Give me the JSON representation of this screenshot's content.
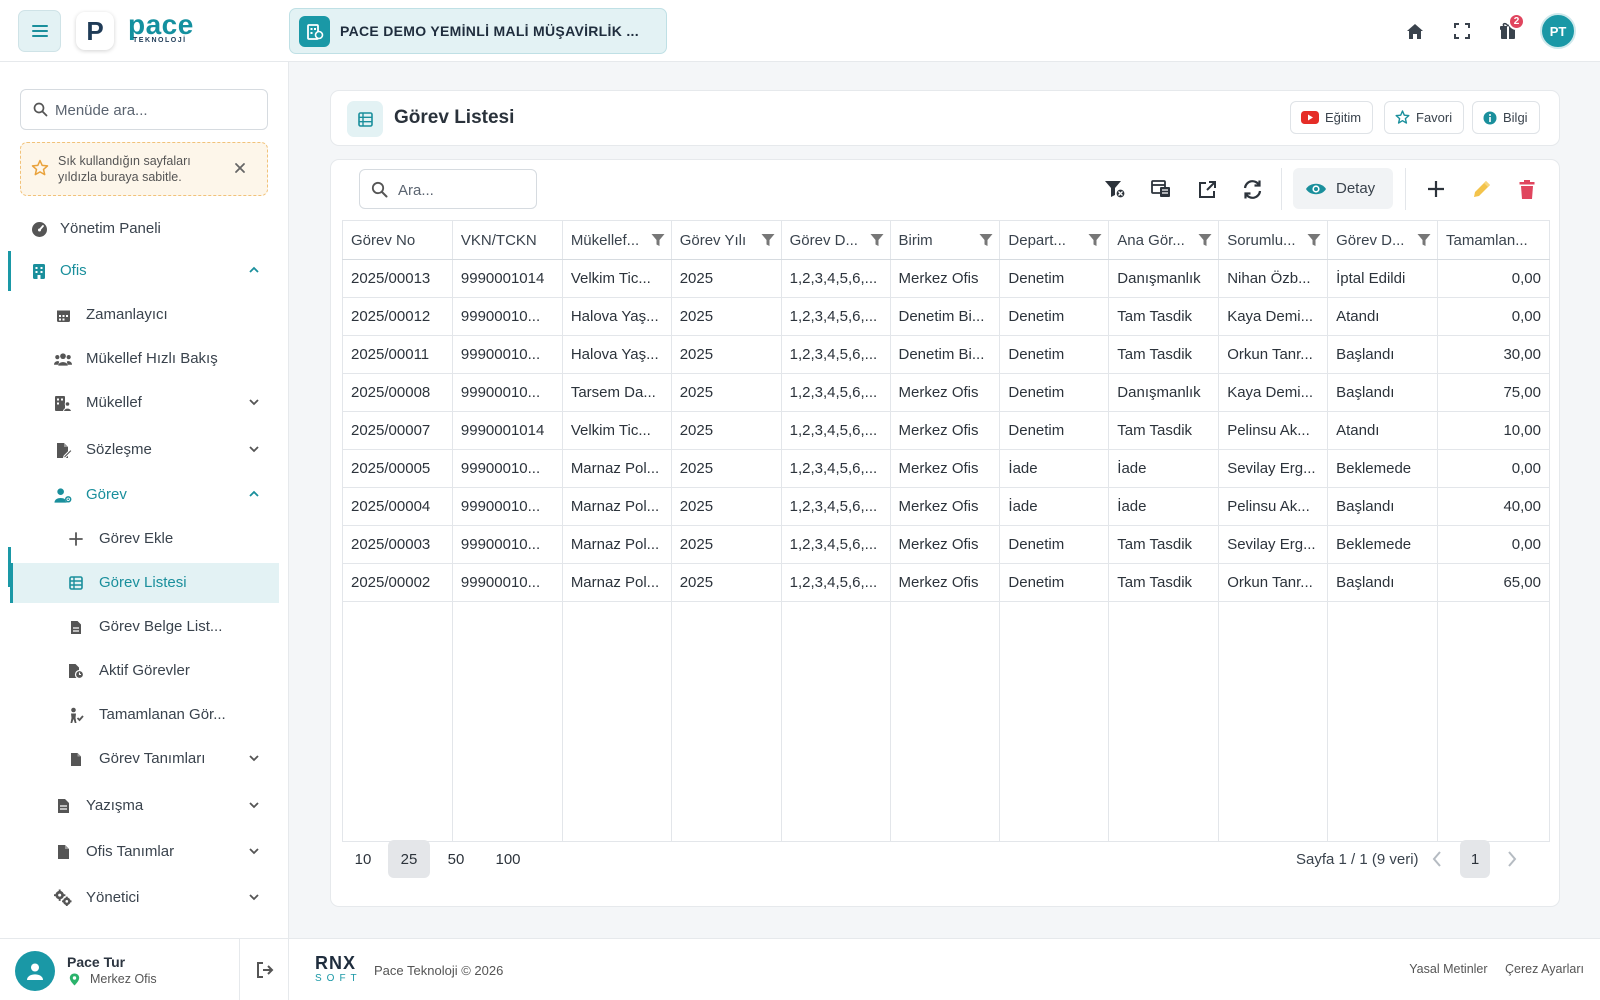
{
  "header": {
    "logo_letter": "P",
    "logo_word": "pace",
    "logo_sub": "TEKNOLOJİ",
    "company_name": "PACE DEMO YEMİNLİ MALİ MÜŞAVİRLİK ...",
    "notification_count": "2",
    "avatar_initials": "PT",
    "accent_color": "#1a98a6"
  },
  "sidebar": {
    "search_placeholder": "Menüde ara...",
    "tip_text": "Sık kullandığın sayfaları yıldızla buraya sabitle.",
    "items": [
      {
        "label": "Yönetim Paneli",
        "icon": "gauge-icon"
      },
      {
        "label": "Ofis",
        "icon": "building-icon"
      },
      {
        "label": "Zamanlayıcı",
        "icon": "calendar-icon"
      },
      {
        "label": "Mükellef Hızlı Bakış",
        "icon": "users-icon"
      },
      {
        "label": "Mükellef",
        "icon": "user-building-icon"
      },
      {
        "label": "Sözleşme",
        "icon": "contract-icon"
      },
      {
        "label": "Görev",
        "icon": "user-gear-icon"
      },
      {
        "label": "Görev Ekle",
        "icon": "plus-icon"
      },
      {
        "label": "Görev Listesi",
        "icon": "table-list-icon"
      },
      {
        "label": "Görev Belge List...",
        "icon": "file-icon"
      },
      {
        "label": "Aktif Görevler",
        "icon": "file-clock-icon"
      },
      {
        "label": "Tamamlanan Gör...",
        "icon": "person-check-icon"
      },
      {
        "label": "Görev Tanımları",
        "icon": "file-lines-icon"
      },
      {
        "label": "Yazışma",
        "icon": "file-text-icon"
      },
      {
        "label": "Ofis Tanımlar",
        "icon": "file-icon"
      },
      {
        "label": "Yönetici",
        "icon": "gears-icon"
      }
    ],
    "user": {
      "name": "Pace Tur",
      "office": "Merkez Ofis"
    }
  },
  "page": {
    "title": "Görev Listesi",
    "buttons": {
      "egitim": "Eğitim",
      "favori": "Favori",
      "bilgi": "Bilgi"
    }
  },
  "grid": {
    "search_placeholder": "Ara...",
    "detail_label": "Detay",
    "columns": [
      "Görev No",
      "VKN/TCKN",
      "Mükellef...",
      "Görev Yılı",
      "Görev D...",
      "Birim",
      "Depart...",
      "Ana Gör...",
      "Sorumlu...",
      "Görev D...",
      "Tamamlan..."
    ],
    "rows": [
      [
        "2025/00013",
        "9990001014",
        "Velkim Tic...",
        "2025",
        "1,2,3,4,5,6,...",
        "Merkez Ofis",
        "Denetim",
        "Danışmanlık",
        "Nihan Özb...",
        "İptal Edildi",
        "0,00"
      ],
      [
        "2025/00012",
        "99900010...",
        "Halova Yaş...",
        "2025",
        "1,2,3,4,5,6,...",
        "Denetim Bi...",
        "Denetim",
        "Tam Tasdik",
        "Kaya Demi...",
        "Atandı",
        "0,00"
      ],
      [
        "2025/00011",
        "99900010...",
        "Halova Yaş...",
        "2025",
        "1,2,3,4,5,6,...",
        "Denetim Bi...",
        "Denetim",
        "Tam Tasdik",
        "Orkun Tanr...",
        "Başlandı",
        "30,00"
      ],
      [
        "2025/00008",
        "99900010...",
        "Tarsem Da...",
        "2025",
        "1,2,3,4,5,6,...",
        "Merkez Ofis",
        "Denetim",
        "Danışmanlık",
        "Kaya Demi...",
        "Başlandı",
        "75,00"
      ],
      [
        "2025/00007",
        "9990001014",
        "Velkim Tic...",
        "2025",
        "1,2,3,4,5,6,...",
        "Merkez Ofis",
        "Denetim",
        "Tam Tasdik",
        "Pelinsu Ak...",
        "Atandı",
        "10,00"
      ],
      [
        "2025/00005",
        "99900010...",
        "Marnaz Pol...",
        "2025",
        "1,2,3,4,5,6,...",
        "Merkez Ofis",
        "İade",
        "İade",
        "Sevilay Erg...",
        "Beklemede",
        "0,00"
      ],
      [
        "2025/00004",
        "99900010...",
        "Marnaz Pol...",
        "2025",
        "1,2,3,4,5,6,...",
        "Merkez Ofis",
        "İade",
        "İade",
        "Pelinsu Ak...",
        "Başlandı",
        "40,00"
      ],
      [
        "2025/00003",
        "99900010...",
        "Marnaz Pol...",
        "2025",
        "1,2,3,4,5,6,...",
        "Merkez Ofis",
        "Denetim",
        "Tam Tasdik",
        "Sevilay Erg...",
        "Beklemede",
        "0,00"
      ],
      [
        "2025/00002",
        "99900010...",
        "Marnaz Pol...",
        "2025",
        "1,2,3,4,5,6,...",
        "Merkez Ofis",
        "Denetim",
        "Tam Tasdik",
        "Orkun Tanr...",
        "Başlandı",
        "65,00"
      ]
    ],
    "page_sizes": [
      "10",
      "25",
      "50",
      "100"
    ],
    "selected_page_size": "25",
    "page_info": "Sayfa 1 / 1 (9 veri)",
    "current_page": "1"
  },
  "footer": {
    "brand_top": "RNX",
    "brand_bottom": "SOFT",
    "copyright": "Pace Teknoloji © 2026",
    "links": [
      "Yasal Metinler",
      "Çerez Ayarları"
    ]
  }
}
